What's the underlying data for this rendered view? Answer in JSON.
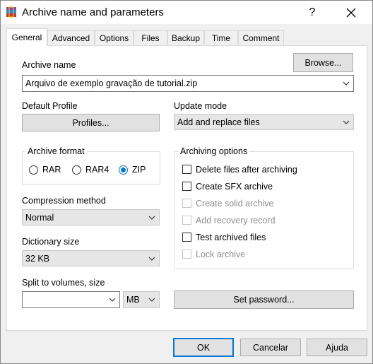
{
  "window": {
    "title": "Archive name and parameters",
    "help_button": "?",
    "close_button": "✕"
  },
  "tabs": [
    {
      "label": "General",
      "active": true
    },
    {
      "label": "Advanced",
      "active": false
    },
    {
      "label": "Options",
      "active": false
    },
    {
      "label": "Files",
      "active": false
    },
    {
      "label": "Backup",
      "active": false
    },
    {
      "label": "Time",
      "active": false
    },
    {
      "label": "Comment",
      "active": false
    }
  ],
  "general": {
    "archive_name_label": "Archive name",
    "browse_label": "Browse...",
    "archive_name_value": "Arquivo de exemplo gravação de tutorial.zip",
    "default_profile_label": "Default Profile",
    "profiles_label": "Profiles...",
    "update_mode_label": "Update mode",
    "update_mode_value": "Add and replace files",
    "archive_format_label": "Archive format",
    "formats": [
      {
        "label": "RAR",
        "selected": false
      },
      {
        "label": "RAR4",
        "selected": false
      },
      {
        "label": "ZIP",
        "selected": true
      }
    ],
    "compression_label": "Compression method",
    "compression_value": "Normal",
    "dictionary_label": "Dictionary size",
    "dictionary_value": "32 KB",
    "split_label": "Split to volumes, size",
    "split_value": "",
    "split_unit": "MB",
    "archiving_options_label": "Archiving options",
    "options": [
      {
        "label": "Delete files after archiving",
        "checked": false,
        "enabled": true
      },
      {
        "label": "Create SFX archive",
        "checked": false,
        "enabled": true
      },
      {
        "label": "Create solid archive",
        "checked": false,
        "enabled": false
      },
      {
        "label": "Add recovery record",
        "checked": false,
        "enabled": false
      },
      {
        "label": "Test archived files",
        "checked": false,
        "enabled": true
      },
      {
        "label": "Lock archive",
        "checked": false,
        "enabled": false
      }
    ],
    "set_password_label": "Set password..."
  },
  "footer": {
    "ok": "OK",
    "cancel": "Cancelar",
    "help": "Ajuda"
  },
  "colors": {
    "accent": "#0078d7",
    "disabled_text": "#8d8d8d"
  }
}
